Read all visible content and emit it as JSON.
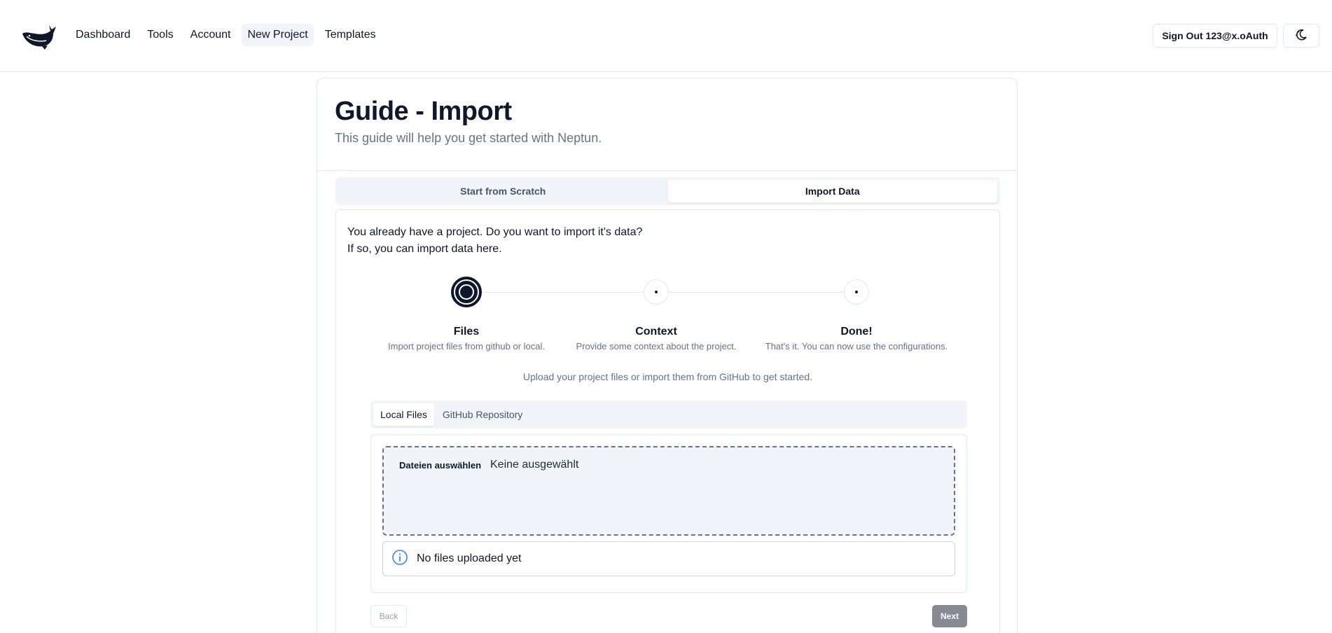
{
  "header": {
    "logo_icon": "whale-logo-icon",
    "nav": [
      {
        "label": "Dashboard",
        "active": false
      },
      {
        "label": "Tools",
        "active": false
      },
      {
        "label": "Account",
        "active": false
      },
      {
        "label": "New Project",
        "active": true
      },
      {
        "label": "Templates",
        "active": false
      }
    ],
    "sign_out_label": "Sign Out 123@x.oAuth",
    "theme_icon": "moon-stars-icon"
  },
  "card": {
    "title": "Guide - Import",
    "subtitle": "This guide will help you get started with Neptun."
  },
  "mode_tabs": [
    {
      "label": "Start from Scratch",
      "active": false
    },
    {
      "label": "Import Data",
      "active": true
    }
  ],
  "intro": {
    "line1": "You already have a project. Do you want to import it's data?",
    "line2": "If so, you can import data here."
  },
  "steps": [
    {
      "title": "Files",
      "description": "Import project files from github or local.",
      "active": true
    },
    {
      "title": "Context",
      "description": "Provide some context about the project.",
      "active": false
    },
    {
      "title": "Done!",
      "description": "That's it. You can now use the configurations.",
      "active": false
    }
  ],
  "upload_hint": "Upload your project files or import them from GitHub to get started.",
  "source_tabs": [
    {
      "label": "Local Files",
      "active": true
    },
    {
      "label": "GitHub Repository",
      "active": false
    }
  ],
  "file_input": {
    "button_label": "Dateien auswählen",
    "status": "Keine ausgewählt"
  },
  "alert": {
    "icon": "info-icon",
    "text": "No files uploaded yet"
  },
  "footer": {
    "back_label": "Back",
    "next_label": "Next"
  },
  "colors": {
    "primary": "#0f172a",
    "muted": "#64748b",
    "border": "#e2e8f0",
    "info": "#3b82f6",
    "disabled_next": "#868a92"
  }
}
